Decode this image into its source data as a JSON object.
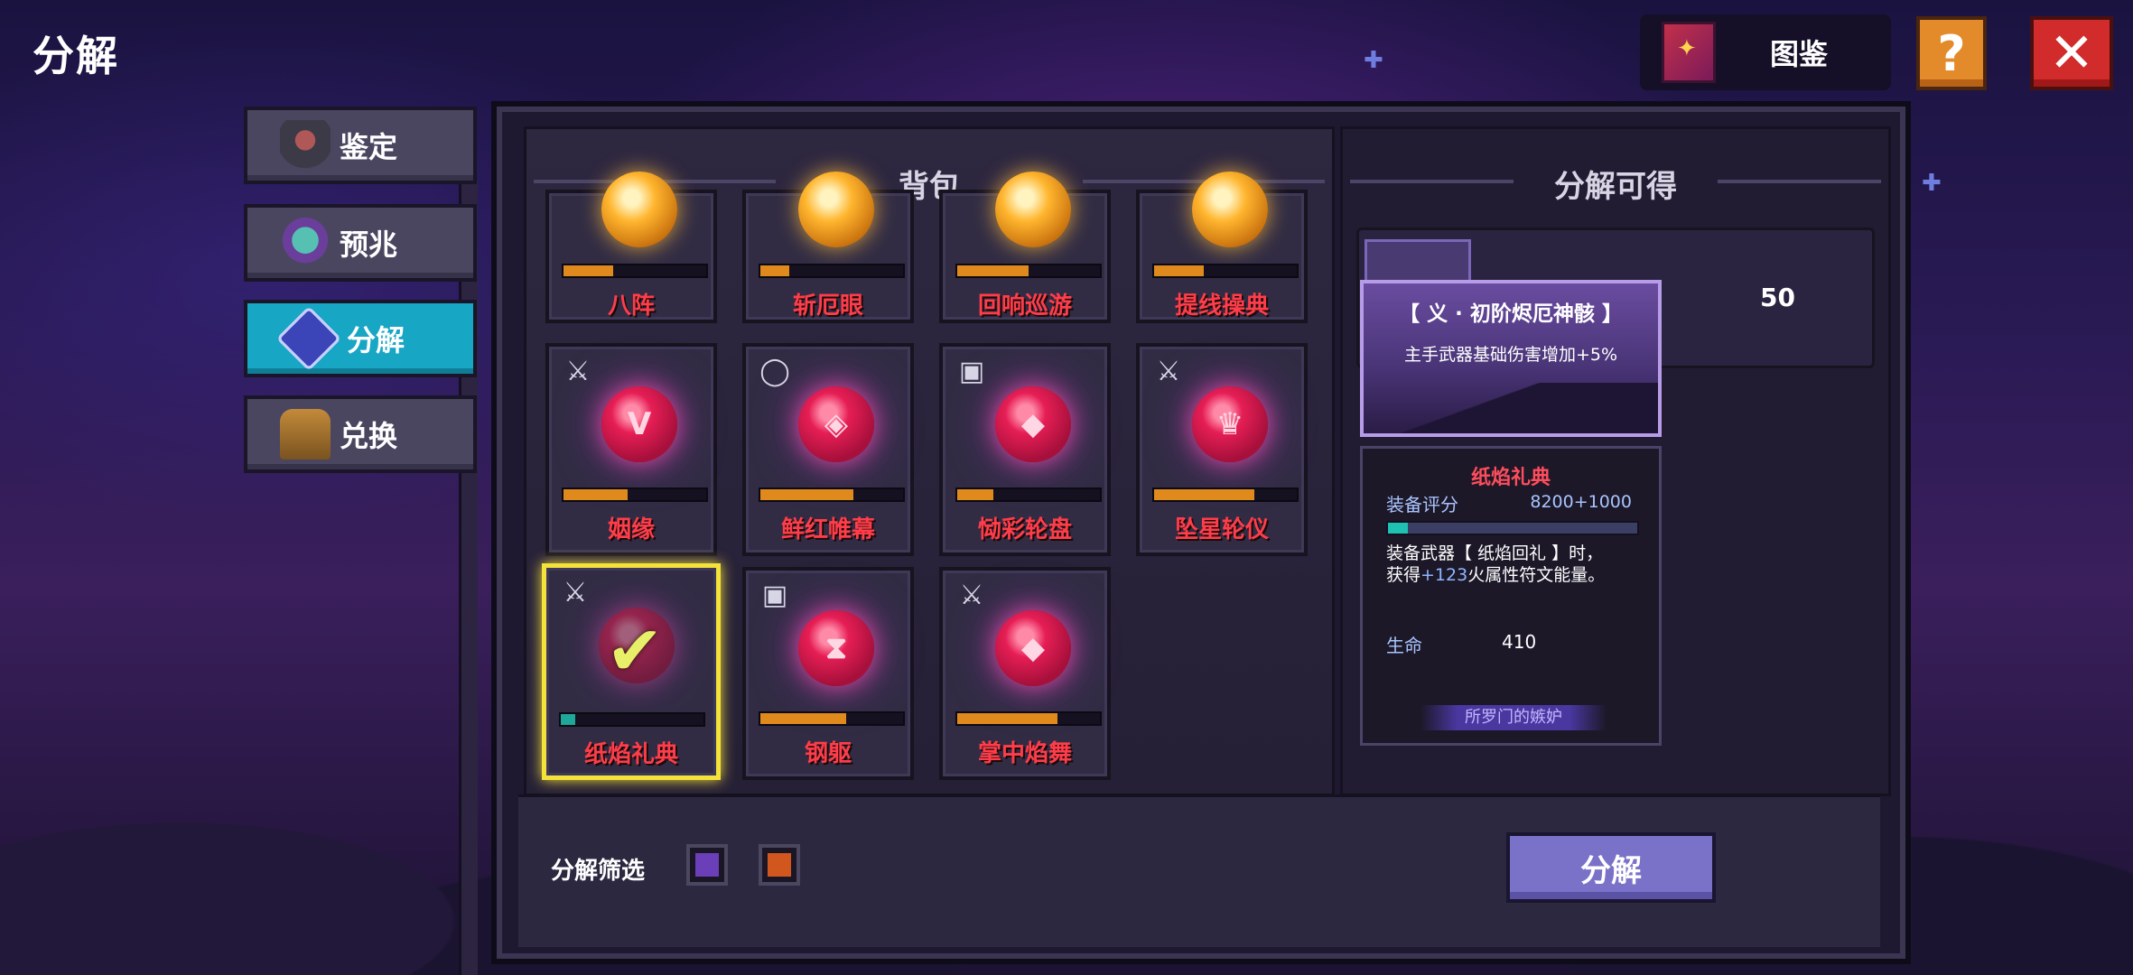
{
  "header": {
    "title": "分解",
    "codex_label": "图鉴",
    "help_label": "?",
    "close_label": "✕"
  },
  "tabs": [
    {
      "label": "鉴定",
      "icon": "identify-icon",
      "active": false
    },
    {
      "label": "预兆",
      "icon": "crystal-ball-icon",
      "active": false
    },
    {
      "label": "分解",
      "icon": "decompose-gem-icon",
      "active": true
    },
    {
      "label": "兑换",
      "icon": "treasure-chest-icon",
      "active": false
    }
  ],
  "bag": {
    "title": "背包",
    "items": [
      {
        "name": "八阵",
        "rarity": "gold",
        "progress": 0.35,
        "type_icon": ""
      },
      {
        "name": "斩厄眼",
        "rarity": "gold",
        "progress": 0.2,
        "type_icon": ""
      },
      {
        "name": "回响巡游",
        "rarity": "gold",
        "progress": 0.5,
        "type_icon": ""
      },
      {
        "name": "提线操典",
        "rarity": "gold",
        "progress": 0.35,
        "type_icon": ""
      },
      {
        "name": "姻缘",
        "rarity": "red",
        "progress": 0.45,
        "type_icon": "weapon-icon"
      },
      {
        "name": "鲜红帷幕",
        "rarity": "red",
        "progress": 0.65,
        "type_icon": "necklace-icon"
      },
      {
        "name": "恸彩轮盘",
        "rarity": "red",
        "progress": 0.25,
        "type_icon": "armor-icon"
      },
      {
        "name": "坠星轮仪",
        "rarity": "red",
        "progress": 0.7,
        "type_icon": "weapon-icon"
      },
      {
        "name": "纸焰礼典",
        "rarity": "red",
        "progress": 0.1,
        "type_icon": "weapon-icon",
        "selected": true
      },
      {
        "name": "钢躯",
        "rarity": "red",
        "progress": 0.6,
        "type_icon": "armor-icon"
      },
      {
        "name": "掌中焰舞",
        "rarity": "red",
        "progress": 0.7,
        "type_icon": "weapon-icon"
      }
    ]
  },
  "rewards": {
    "title": "分解可得",
    "items": [
      {
        "icon": "purple-scroll-icon",
        "count": "50"
      }
    ]
  },
  "tooltip": {
    "title": "【 义 · 初阶烬厄神骸 】",
    "effect": "主手武器基础伤害增加+5%",
    "item_name": "纸焰礼典",
    "score_label": "装备评分",
    "score_value": "8200+1000",
    "score_fill": 0.08,
    "desc_prefix": "装备武器【 纸焰回礼 】时，",
    "desc_line2_a": "获得",
    "desc_line2_hl": "+123",
    "desc_line2_b": "火属性符文能量。",
    "stat_label": "生命",
    "stat_value": "410",
    "set_name": "所罗门的嫉妒"
  },
  "footer": {
    "filter_label": "分解筛选",
    "filters": [
      {
        "color": "#6b3fb8"
      },
      {
        "color": "#d2571e"
      }
    ],
    "decompose_button": "分解"
  },
  "colors": {
    "accent_tab": "#17a6c4",
    "item_name": "#ff3d4a",
    "selected_border": "#f4e13a",
    "decompose_button": "#7a72c8"
  }
}
